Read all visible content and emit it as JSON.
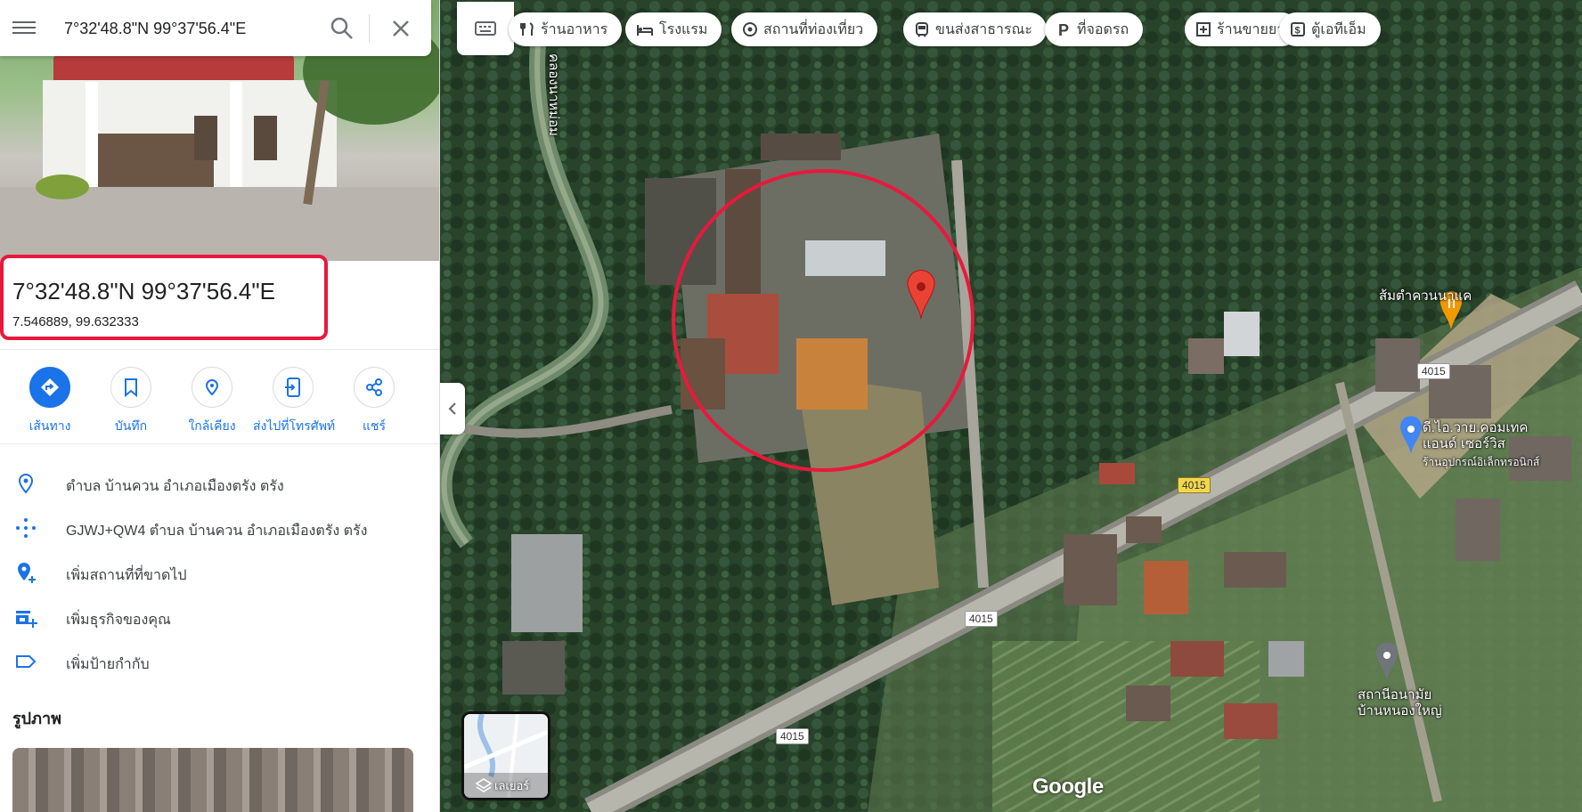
{
  "search": {
    "value": "7°32'48.8\"N 99°37'56.4\"E"
  },
  "place": {
    "title": "7°32'48.8\"N 99°37'56.4\"E",
    "decimal": "7.546889, 99.632333"
  },
  "actions": [
    {
      "label": "เส้นทาง",
      "icon": "directions-icon"
    },
    {
      "label": "บันทึก",
      "icon": "bookmark-icon"
    },
    {
      "label": "ใกล้เคียง",
      "icon": "nearby-icon"
    },
    {
      "label": "ส่งไปที่โทรศัพท์",
      "icon": "send-to-phone-icon"
    },
    {
      "label": "แชร์",
      "icon": "share-icon"
    }
  ],
  "info": [
    {
      "text": "ตำบล บ้านควน อำเภอเมืองตรัง ตรัง",
      "icon": "location-pin-icon"
    },
    {
      "text": "GJWJ+QW4 ตำบล บ้านควน อำเภอเมืองตรัง ตรัง",
      "icon": "plus-code-icon"
    },
    {
      "text": "เพิ่มสถานที่ที่ขาดไป",
      "icon": "add-place-icon"
    },
    {
      "text": "เพิ่มธุรกิจของคุณ",
      "icon": "add-business-icon"
    },
    {
      "text": "เพิ่มป้ายกำกับ",
      "icon": "label-icon"
    }
  ],
  "photos": {
    "heading": "รูปภาพ"
  },
  "chips": [
    {
      "label": "ร้านอาหาร",
      "icon": "restaurant-icon"
    },
    {
      "label": "โรงแรม",
      "icon": "hotel-icon"
    },
    {
      "label": "สถานที่ท่องเที่ยว",
      "icon": "attraction-icon"
    },
    {
      "label": "ขนส่งสาธารณะ",
      "icon": "transit-icon"
    },
    {
      "label": "ที่จอดรถ",
      "icon": "parking-icon"
    },
    {
      "label": "ร้านขายยา",
      "icon": "pharmacy-icon"
    },
    {
      "label": "ตู้เอทีเอ็ม",
      "icon": "atm-icon"
    }
  ],
  "map": {
    "canal_label": "คลองนาหม่อม",
    "pois": [
      {
        "name": "ส้มตำควนนาแค",
        "type": "restaurant",
        "color": "#f29900"
      },
      {
        "name": "ดี.ไอ.วาย.คอมเทค แอนด์ เซอร์วิส",
        "sub": "ร้านอุปกรณ์อิเล็กทรอนิกส์",
        "type": "shop",
        "color": "#4285f4"
      },
      {
        "name": "สถานีอนามัยบ้านหนองใหญ่",
        "type": "health",
        "color": "#70757a"
      }
    ],
    "roads": [
      "4015",
      "4015",
      "4015",
      "4015"
    ],
    "layers_label": "เลเยอร์",
    "logo": "Google",
    "pin_color": "#ea4335",
    "highlight_color": "#e8193c"
  }
}
